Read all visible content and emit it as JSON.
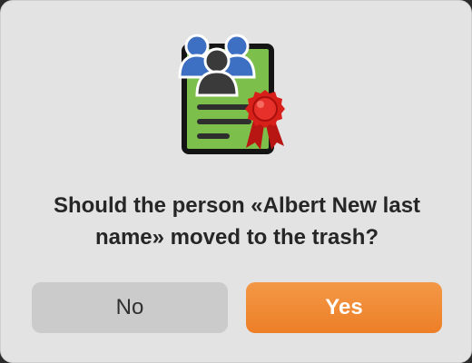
{
  "dialog": {
    "icon": "person-certificate-icon",
    "message": "Should the person «Albert New last name» moved to the trash?",
    "buttons": {
      "no_label": "No",
      "yes_label": "Yes"
    }
  },
  "colors": {
    "dialog_background": "#e3e3e3",
    "primary_button": "#ef8530",
    "secondary_button": "#cbcbcb",
    "icon_card": "#7cbf4a",
    "icon_people": "#3d6fc2",
    "icon_seal": "#d8201a"
  }
}
